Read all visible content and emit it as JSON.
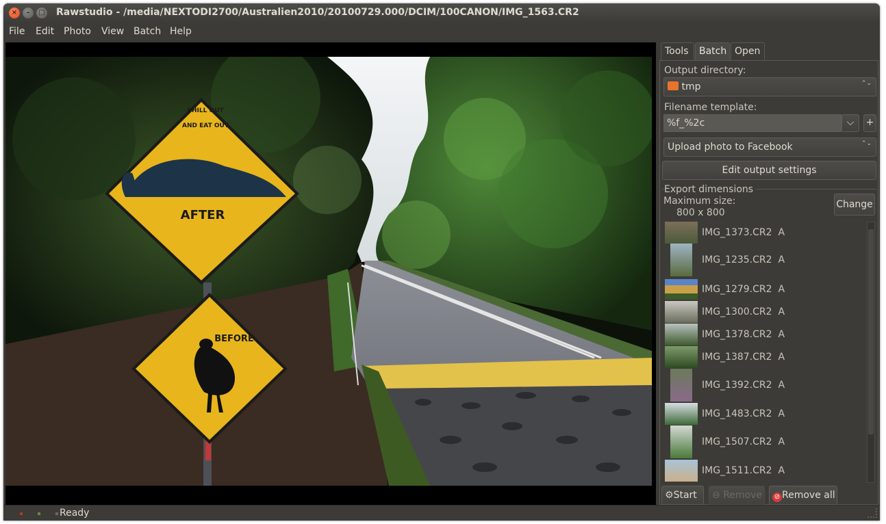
{
  "window": {
    "title": "Rawstudio - /media/NEXTODI2700/Australien2010/20100729.000/DCIM/100CANON/IMG_1563.CR2",
    "close_glyph": "×",
    "min_glyph": "–",
    "max_glyph": "□"
  },
  "menu": [
    "File",
    "Edit",
    "Photo",
    "View",
    "Batch",
    "Help"
  ],
  "sign_top": {
    "line1": "CHILL OUT",
    "line2": "AND EAT OUT",
    "word": "AFTER"
  },
  "sign_bottom": {
    "word": "BEFORE"
  },
  "tabs": [
    {
      "label": "Tools",
      "active": false
    },
    {
      "label": "Batch",
      "active": true
    },
    {
      "label": "Open",
      "active": false
    }
  ],
  "batch": {
    "output_directory_label": "Output directory:",
    "output_directory_value": "tmp",
    "filename_template_label": "Filename template:",
    "filename_template_value": "%f_%2c",
    "plus_glyph": "+",
    "dropdown_glyph": "⌵",
    "updown_glyph": "⌃⌄",
    "upload_target": "Upload photo to Facebook",
    "edit_output_button": "Edit output settings",
    "export_dimensions_label": "Export dimensions",
    "maximum_size_label": "Maximum size:",
    "maximum_size_value": "800 x 800",
    "change_button": "Change"
  },
  "queue": [
    {
      "name": "IMG_1373.CR2",
      "setting": "A"
    },
    {
      "name": "IMG_1235.CR2",
      "setting": "A"
    },
    {
      "name": "IMG_1279.CR2",
      "setting": "A"
    },
    {
      "name": "IMG_1300.CR2",
      "setting": "A"
    },
    {
      "name": "IMG_1378.CR2",
      "setting": "A"
    },
    {
      "name": "IMG_1387.CR2",
      "setting": "A"
    },
    {
      "name": "IMG_1392.CR2",
      "setting": "A"
    },
    {
      "name": "IMG_1483.CR2",
      "setting": "A"
    },
    {
      "name": "IMG_1507.CR2",
      "setting": "A"
    },
    {
      "name": "IMG_1511.CR2",
      "setting": "A"
    }
  ],
  "buttons": {
    "start": "Start",
    "remove": "Remove",
    "remove_all": "Remove all"
  },
  "status": {
    "text": "Ready"
  },
  "colors": {
    "window_bg": "#3c3b37",
    "text": "#dfdbd2",
    "close_button": "#e85c2a",
    "sign_yellow": "#e8b51c"
  }
}
